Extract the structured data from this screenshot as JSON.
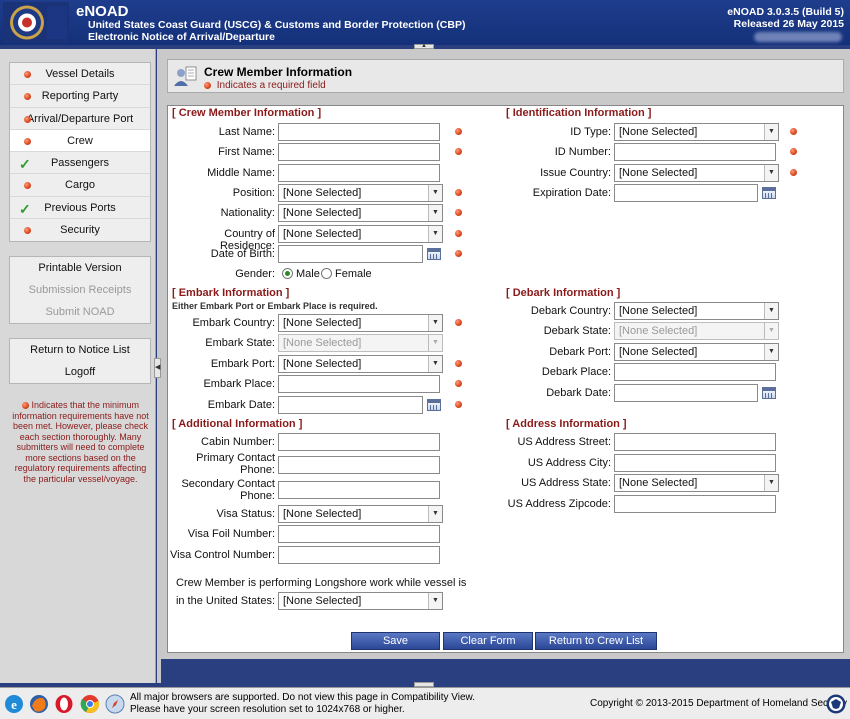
{
  "header": {
    "app_title": "eNOAD",
    "agency": "United States Coast Guard (USCG) & Customs and Border Protection (CBP)",
    "subtitle": "Electronic Notice of Arrival/Departure",
    "version": "eNOAD 3.0.3.5 (Build 5)",
    "released": "Released 26 May 2015"
  },
  "sidebar": {
    "nav_items": [
      {
        "label": "Vessel Details",
        "status": "incomplete"
      },
      {
        "label": "Reporting Party",
        "status": "incomplete"
      },
      {
        "label": "Arrival/Departure Port",
        "status": "incomplete"
      },
      {
        "label": "Crew",
        "status": "incomplete"
      },
      {
        "label": "Passengers",
        "status": "complete"
      },
      {
        "label": "Cargo",
        "status": "incomplete"
      },
      {
        "label": "Previous Ports",
        "status": "complete"
      },
      {
        "label": "Security",
        "status": "incomplete"
      }
    ],
    "printable_version": "Printable Version",
    "submission_receipts": "Submission Receipts",
    "submit_noad": "Submit NOAD",
    "return_to_notice_list": "Return to Notice List",
    "logoff": "Logoff",
    "legend_note": "Indicates that the minimum information requirements have not been met. However, please check each section thoroughly. Many submitters will need to complete more sections based on the regulatory requirements affecting the particular vessel/voyage."
  },
  "page": {
    "title": "Crew Member Information",
    "required_note": "Indicates a required field"
  },
  "crew_info": {
    "section_title": "[ Crew Member Information ]",
    "last_name_label": "Last Name:",
    "first_name_label": "First Name:",
    "middle_name_label": "Middle Name:",
    "position_label": "Position:",
    "position_value": "[None Selected]",
    "nationality_label": "Nationality:",
    "nationality_value": "[None Selected]",
    "residence_label": "Country of Residence:",
    "residence_value": "[None Selected]",
    "dob_label": "Date of Birth:",
    "gender_label": "Gender:",
    "gender_male": "Male",
    "gender_female": "Female"
  },
  "identification": {
    "section_title": "[ Identification Information ]",
    "id_type_label": "ID Type:",
    "id_type_value": "[None Selected]",
    "id_number_label": "ID Number:",
    "issue_country_label": "Issue Country:",
    "issue_country_value": "[None Selected]",
    "expiration_label": "Expiration Date:"
  },
  "embark": {
    "section_title": "[ Embark Information ]",
    "note": "Either Embark Port or Embark Place is required.",
    "country_label": "Embark Country:",
    "country_value": "[None Selected]",
    "state_label": "Embark State:",
    "state_value": "[None Selected]",
    "port_label": "Embark Port:",
    "port_value": "[None Selected]",
    "place_label": "Embark Place:",
    "date_label": "Embark Date:"
  },
  "debark": {
    "section_title": "[ Debark Information ]",
    "country_label": "Debark Country:",
    "country_value": "[None Selected]",
    "state_label": "Debark State:",
    "state_value": "[None Selected]",
    "port_label": "Debark Port:",
    "port_value": "[None Selected]",
    "place_label": "Debark Place:",
    "date_label": "Debark Date:"
  },
  "additional": {
    "section_title": "[ Additional Information ]",
    "cabin_label": "Cabin Number:",
    "primary_phone_label_1": "Primary Contact",
    "primary_phone_label_2": "Phone:",
    "secondary_phone_label_1": "Secondary Contact",
    "secondary_phone_label_2": "Phone:",
    "visa_status_label": "Visa Status:",
    "visa_status_value": "[None Selected]",
    "visa_foil_label": "Visa Foil Number:",
    "visa_control_label": "Visa Control Number:",
    "longshore_label_1": "Crew Member is performing Longshore work while vessel is",
    "longshore_label_2": "in the United States:",
    "longshore_value": "[None Selected]"
  },
  "address": {
    "section_title": "[ Address Information ]",
    "street_label": "US Address Street:",
    "city_label": "US Address City:",
    "state_label": "US Address State:",
    "state_value": "[None Selected]",
    "zip_label": "US Address Zipcode:"
  },
  "actions": {
    "save": "Save",
    "clear": "Clear Form",
    "return_crew": "Return to Crew List"
  },
  "footer": {
    "line1": "All major browsers are supported. Do not view this page in Compatibility View.",
    "line2": "Please have your screen resolution set to 1024x768 or higher.",
    "copyright": "Copyright © 2013-2015 Department of Homeland Security"
  },
  "colors": {
    "header_blue": "#1e3d8c",
    "required_red": "#d9461c",
    "section_maroon": "#8a1a1a",
    "complete_green": "#2f9a2f",
    "button_blue": "#2b4796"
  },
  "icons": {
    "seal": "uscg-seal-icon",
    "title": "crew-member-icon",
    "calendar": "calendar-icon",
    "complete": "checkmark-icon",
    "required": "required-dot-icon"
  }
}
